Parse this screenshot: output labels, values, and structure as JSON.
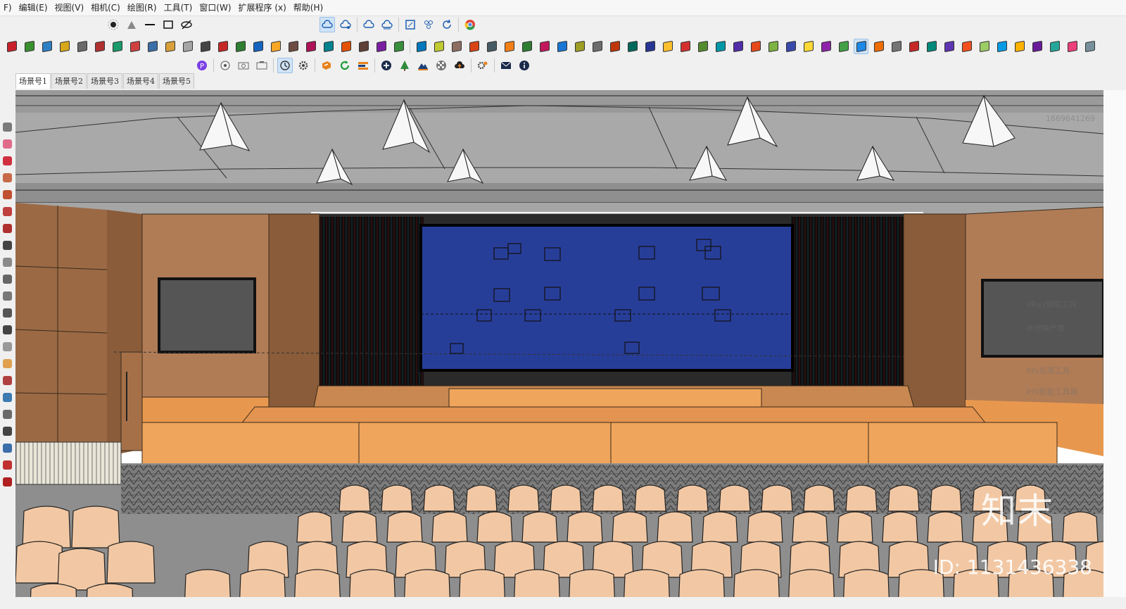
{
  "menu": {
    "items": [
      "F)",
      "编辑(E)",
      "视图(V)",
      "相机(C)",
      "绘图(R)",
      "工具(T)",
      "窗口(W)",
      "扩展程序 (x)",
      "帮助(H)"
    ]
  },
  "toolbar_row1": {
    "left_icons": [
      "shadow-icon",
      "fog-icon",
      "line-style-icon",
      "rectangle-icon",
      "hide-icon"
    ],
    "right_icons": [
      "cloud-sync-icon",
      "cloud-share-icon",
      "cloud-upload-icon",
      "cloud-download-icon",
      "frame-icon",
      "components-icon",
      "refresh-icon",
      "chrome-icon"
    ]
  },
  "toolbar_row2": {
    "icon_colors": [
      "#c8202a",
      "#3a8f2e",
      "#2d7fc4",
      "#d6a81a",
      "#6a6a6a",
      "#b03030",
      "#1a9a6a",
      "#d04040",
      "#3c6ea8",
      "#d9a03a",
      "#a5a5a5",
      "#444444",
      "#c62828",
      "#2e7d32",
      "#1565c0",
      "#f9a825",
      "#6d4c41",
      "#ad1457",
      "#00838f",
      "#e65100",
      "#5d4037",
      "#7b1fa2",
      "#388e3c",
      "#0277bd",
      "#c0ca33",
      "#8d6e63",
      "#d84315",
      "#455a64",
      "#f57f17",
      "#2e7d32",
      "#c2185b",
      "#1976d2",
      "#9e9d24",
      "#6d6d6d",
      "#bf360c",
      "#00695c",
      "#283593",
      "#fbc02d",
      "#d32f2f",
      "#558b2f",
      "#0097a7",
      "#512da8",
      "#e64a19",
      "#7cb342",
      "#3949ab",
      "#fdd835",
      "#8e24aa",
      "#43a047",
      "#1e88e5",
      "#ef6c00",
      "#757575",
      "#c62828",
      "#00897b",
      "#5e35b1",
      "#f4511e",
      "#9ccc65",
      "#039be5",
      "#ffb300",
      "#6a1b9a",
      "#26a69a",
      "#ec407a",
      "#78909c"
    ]
  },
  "toolbar_row3": {
    "icons": [
      "plugin-p-icon",
      "orbit-icon",
      "camera-icon",
      "camera2-icon",
      "clock-icon",
      "settings-gear-icon",
      "sketchup-logo-icon",
      "refresh-green-icon",
      "bars-icon",
      "add-icon",
      "tree-icon",
      "terrain-icon",
      "checker-icon",
      "cloud-upload-icon",
      "cog-icon",
      "mail-icon",
      "info-icon"
    ]
  },
  "scenes": {
    "tabs": [
      "场景号1",
      "场景号2",
      "场景号3",
      "场景号4",
      "场景号5"
    ],
    "active_index": 0
  },
  "left_toolbar": {
    "icons": [
      "select-icon",
      "eraser-icon",
      "freehand-icon",
      "rectangle-icon",
      "circle-icon",
      "arc-icon",
      "pushpull-icon",
      "move-icon",
      "rotate-icon",
      "scale-icon",
      "offset-icon",
      "tape-icon",
      "text-icon",
      "axes-icon",
      "paint-icon",
      "orbit-icon",
      "pan-icon",
      "zoom-icon",
      "walk-icon",
      "section-icon",
      "look-icon",
      "position-icon"
    ]
  },
  "watermark": {
    "logo": "知末",
    "id": "ID: 1131436338"
  },
  "right_panel_faint": [
    "1669641269",
    "VRay辅助工具",
    "本地资产库",
    "IHS处理工具",
    "IHS智能工具箱"
  ]
}
